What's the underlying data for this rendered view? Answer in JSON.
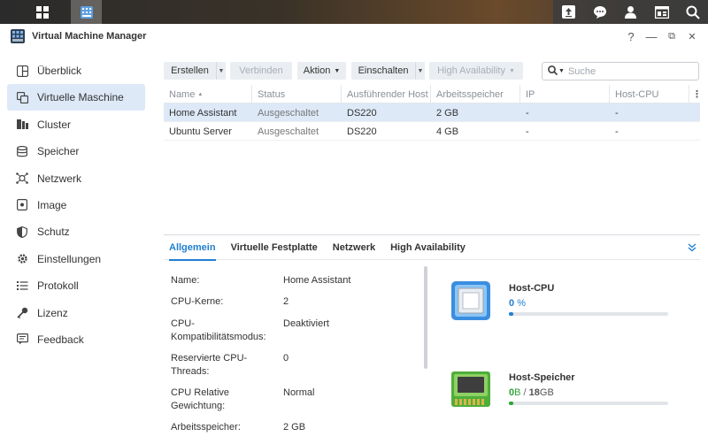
{
  "colors": {
    "accent": "#1f7fd0",
    "selected_row": "#dde9f7",
    "memory_green": "#2aa632",
    "cpu_blue": "#1f7fd0"
  },
  "taskbar": {
    "left_icons": [
      "main-menu-icon",
      "vmm-app-icon"
    ],
    "right_icons": [
      "upload-icon",
      "chat-icon",
      "user-icon",
      "widgets-icon",
      "search-icon"
    ]
  },
  "window": {
    "title": "Virtual Machine Manager",
    "controls": {
      "help": "?",
      "minimize": "—",
      "maximize": "⧉",
      "close": "✕"
    }
  },
  "sidebar": {
    "items": [
      {
        "label": "Überblick",
        "icon": "overview-icon"
      },
      {
        "label": "Virtuelle Maschine",
        "icon": "virtual-machine-icon",
        "active": true
      },
      {
        "label": "Cluster",
        "icon": "cluster-icon"
      },
      {
        "label": "Speicher",
        "icon": "storage-icon"
      },
      {
        "label": "Netzwerk",
        "icon": "network-icon"
      },
      {
        "label": "Image",
        "icon": "image-icon"
      },
      {
        "label": "Schutz",
        "icon": "shield-icon"
      },
      {
        "label": "Einstellungen",
        "icon": "gear-icon"
      },
      {
        "label": "Protokoll",
        "icon": "log-icon"
      },
      {
        "label": "Lizenz",
        "icon": "key-icon"
      },
      {
        "label": "Feedback",
        "icon": "feedback-icon"
      }
    ]
  },
  "toolbar": {
    "create": "Erstellen",
    "connect": "Verbinden",
    "action": "Aktion",
    "power_on": "Einschalten",
    "high_availability": "High Availability",
    "search_placeholder": "Suche"
  },
  "table": {
    "columns": [
      "Name",
      "Status",
      "Ausführender Host",
      "Arbeitsspeicher",
      "IP",
      "Host-CPU"
    ],
    "sort_indicator": "▲",
    "rows": [
      {
        "name": "Home Assistant",
        "status": "Ausgeschaltet",
        "host": "DS220",
        "memory": "2 GB",
        "ip": "-",
        "cpu": "-"
      },
      {
        "name": "Ubuntu Server",
        "status": "Ausgeschaltet",
        "host": "DS220",
        "memory": "4 GB",
        "ip": "-",
        "cpu": "-"
      }
    ]
  },
  "detail": {
    "tabs": [
      "Allgemein",
      "Virtuelle Festplatte",
      "Netzwerk",
      "High Availability"
    ],
    "properties": [
      {
        "label": "Name:",
        "value": "Home Assistant"
      },
      {
        "label": "CPU-Kerne:",
        "value": "2"
      },
      {
        "label": "CPU-Kompatibilitätsmodus:",
        "value": "Deaktiviert"
      },
      {
        "label": "Reservierte CPU-Threads:",
        "value": "0"
      },
      {
        "label": "CPU Relative Gewichtung:",
        "value": "Normal"
      },
      {
        "label": "Arbeitsspeicher:",
        "value": "2 GB"
      }
    ],
    "host_cpu": {
      "title": "Host-CPU",
      "value": "0",
      "unit": "%",
      "fraction": 0.03
    },
    "host_memory": {
      "title": "Host-Speicher",
      "used": "0",
      "used_unit": "B",
      "separator": "/",
      "total": "18",
      "total_unit": "GB",
      "fraction": 0.03
    }
  }
}
